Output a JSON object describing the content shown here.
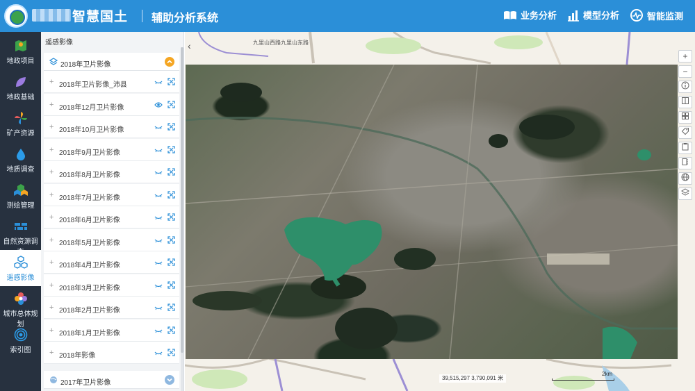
{
  "header": {
    "title": "智慧国土",
    "subtitle": "辅助分析系统",
    "nav": [
      {
        "label": "业务分析",
        "icon": "book-icon"
      },
      {
        "label": "模型分析",
        "icon": "bar-chart-icon"
      },
      {
        "label": "智能监测",
        "icon": "monitor-icon"
      }
    ]
  },
  "sidebar": {
    "items": [
      {
        "label": "地政项目",
        "icon": "map-pin-icon",
        "active": false
      },
      {
        "label": "地政基础",
        "icon": "leaf-icon",
        "active": false
      },
      {
        "label": "矿产资源",
        "icon": "pinwheel-icon",
        "active": false
      },
      {
        "label": "地质调查",
        "icon": "water-drop-icon",
        "active": false
      },
      {
        "label": "测绘管理",
        "icon": "cubes-icon",
        "active": false
      },
      {
        "label": "自然资源调查",
        "icon": "bricks-icon",
        "active": false
      },
      {
        "label": "遥感影像",
        "icon": "molecule-icon",
        "active": true
      },
      {
        "label": "城市总体规划",
        "icon": "flower-icon",
        "active": false
      },
      {
        "label": "索引图",
        "icon": "signal-icon",
        "active": false
      }
    ]
  },
  "panel": {
    "title": "遥感影像",
    "groups": [
      {
        "label": "2018年卫片影像",
        "expanded": true
      },
      {
        "label": "2017年卫片影像",
        "expanded": false
      }
    ],
    "layers": [
      {
        "label": "2018年卫片影像_沛县",
        "visible": false
      },
      {
        "label": "2018年12月卫片影像",
        "visible": true
      },
      {
        "label": "2018年10月卫片影像",
        "visible": false
      },
      {
        "label": "2018年9月卫片影像",
        "visible": false
      },
      {
        "label": "2018年8月卫片影像",
        "visible": false
      },
      {
        "label": "2018年7月卫片影像",
        "visible": false
      },
      {
        "label": "2018年6月卫片影像",
        "visible": false
      },
      {
        "label": "2018年5月卫片影像",
        "visible": false
      },
      {
        "label": "2018年4月卫片影像",
        "visible": false
      },
      {
        "label": "2018年3月卫片影像",
        "visible": false
      },
      {
        "label": "2018年2月卫片影像",
        "visible": false
      },
      {
        "label": "2018年1月卫片影像",
        "visible": false
      },
      {
        "label": "2018年影像",
        "visible": false
      }
    ]
  },
  "map": {
    "road_label": "九里山西路九里山东路",
    "coordinates": "39,515,297 3,790,091 米",
    "scale_label": "2km",
    "zoom_in": "+",
    "zoom_out": "−"
  },
  "colors": {
    "header_bg": "#2b8fd8",
    "sidebar_bg": "#27313f",
    "accent": "#2b8fd8",
    "group_toggle_open": "#f5a623",
    "group_toggle_closed": "#8fb8e0",
    "lake": "#2e8f6a"
  }
}
